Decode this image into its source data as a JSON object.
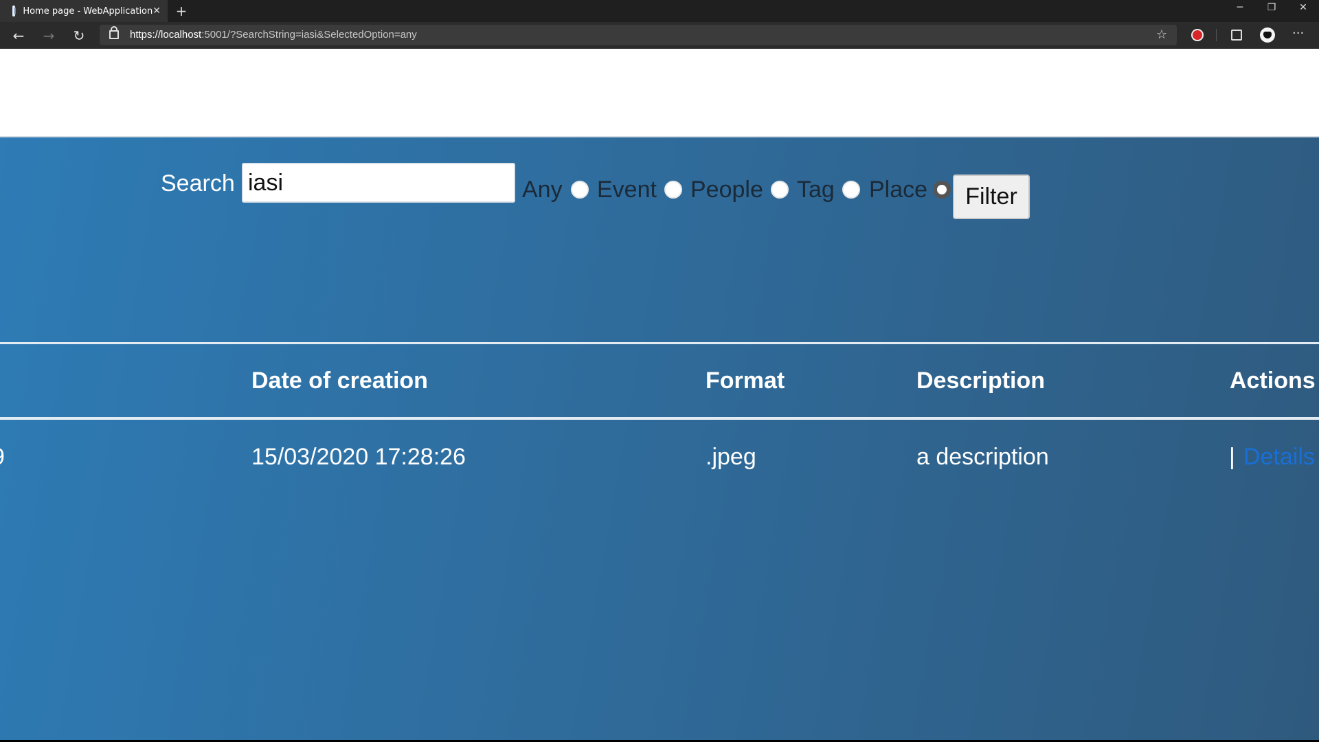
{
  "browser": {
    "tab_title": "Home page - WebApplication",
    "tab_close": "✕",
    "new_tab": "+",
    "url_scheme_host": "https://localhost",
    "url_rest": ":5001/?SearchString=iasi&SelectedOption=any",
    "window_minimize": "─",
    "window_restore": "❐",
    "window_close": "✕",
    "more_menu": "···",
    "favorite": "☆",
    "back": "←",
    "forward": "→",
    "refresh": "↻"
  },
  "search": {
    "label": "Search",
    "value": "iasi",
    "filter_label": "Filter",
    "options": [
      {
        "label": "Any",
        "checked": false
      },
      {
        "label": "Event",
        "checked": false
      },
      {
        "label": "People",
        "checked": false
      },
      {
        "label": "Tag",
        "checked": false
      },
      {
        "label": "Place",
        "checked": true
      }
    ]
  },
  "table": {
    "headers": [
      "Date of creation",
      "Format",
      "Description",
      "Actions"
    ],
    "rows": [
      {
        "partial_first_cell": "9",
        "date": "15/03/2020 17:28:26",
        "format": ".jpeg",
        "description": "a description",
        "actions_separator": "|",
        "actions_link": "Details"
      }
    ]
  }
}
